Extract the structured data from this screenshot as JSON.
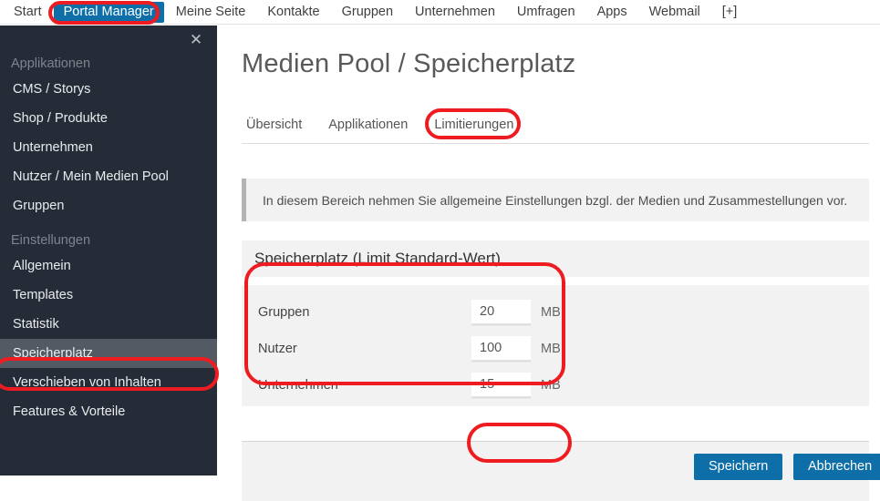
{
  "topnav": {
    "items": [
      {
        "label": "Start",
        "active": false
      },
      {
        "label": "Portal Manager",
        "active": true
      },
      {
        "label": "Meine Seite",
        "active": false
      },
      {
        "label": "Kontakte",
        "active": false
      },
      {
        "label": "Gruppen",
        "active": false
      },
      {
        "label": "Unternehmen",
        "active": false
      },
      {
        "label": "Umfragen",
        "active": false
      },
      {
        "label": "Apps",
        "active": false
      },
      {
        "label": "Webmail",
        "active": false
      },
      {
        "label": "[+]",
        "active": false
      }
    ]
  },
  "sidebar": {
    "close_icon": "✕",
    "sections": [
      {
        "title": "Applikationen",
        "items": [
          {
            "label": "CMS / Storys",
            "selected": false
          },
          {
            "label": "Shop / Produkte",
            "selected": false
          },
          {
            "label": "Unternehmen",
            "selected": false
          },
          {
            "label": "Nutzer / Mein Medien Pool",
            "selected": false
          },
          {
            "label": "Gruppen",
            "selected": false
          }
        ]
      },
      {
        "title": "Einstellungen",
        "items": [
          {
            "label": "Allgemein",
            "selected": false
          },
          {
            "label": "Templates",
            "selected": false
          },
          {
            "label": "Statistik",
            "selected": false
          },
          {
            "label": "Speicherplatz",
            "selected": true
          },
          {
            "label": "Verschieben von Inhalten",
            "selected": false
          },
          {
            "label": "Features & Vorteile",
            "selected": false
          }
        ]
      }
    ]
  },
  "main": {
    "page_title": "Medien Pool / Speicherplatz",
    "tabs": [
      {
        "label": "Übersicht",
        "active": false
      },
      {
        "label": "Applikationen",
        "active": false
      },
      {
        "label": "Limitierungen",
        "active": true
      }
    ],
    "info_text": "In diesem Bereich nehmen Sie allgemeine Einstellungen bzgl. der Medien und Zusammestellungen vor.",
    "panel_title": "Speicherplatz (Limit Standard-Wert)",
    "form_rows": [
      {
        "label": "Gruppen",
        "value": "20",
        "unit": "MB"
      },
      {
        "label": "Nutzer",
        "value": "100",
        "unit": "MB"
      },
      {
        "label": "Unternehmen",
        "value": "15",
        "unit": "MB"
      }
    ],
    "buttons": {
      "save": "Speichern",
      "cancel": "Abbrechen"
    }
  },
  "colors": {
    "accent_blue": "#0d6ea8",
    "sidebar_bg": "#252c37",
    "sidebar_selected": "#535a63",
    "panel_bg": "#f2f2f2",
    "annotation_red": "#ee1c21"
  }
}
